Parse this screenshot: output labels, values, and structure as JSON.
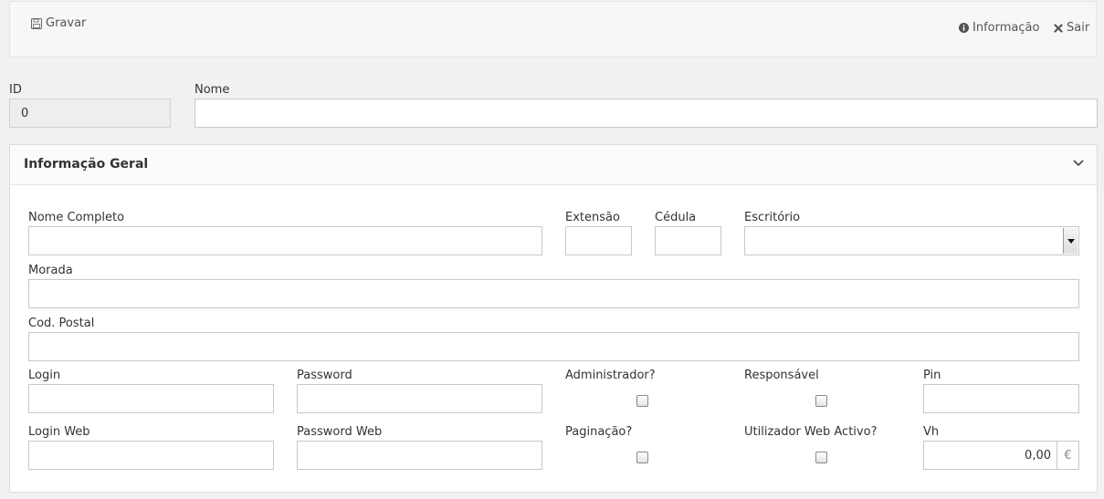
{
  "toolbar": {
    "save_label": "Gravar",
    "info_label": "Informação",
    "exit_label": "Sair"
  },
  "header_fields": {
    "id_label": "ID",
    "id_value": "0",
    "nome_label": "Nome",
    "nome_value": ""
  },
  "panel": {
    "title": "Informação Geral",
    "fields": {
      "nome_completo": {
        "label": "Nome Completo",
        "value": ""
      },
      "extensao": {
        "label": "Extensão",
        "value": ""
      },
      "cedula": {
        "label": "Cédula",
        "value": ""
      },
      "escritorio": {
        "label": "Escritório",
        "value": ""
      },
      "morada": {
        "label": "Morada",
        "value": ""
      },
      "cod_postal": {
        "label": "Cod. Postal",
        "value": ""
      },
      "login": {
        "label": "Login",
        "value": ""
      },
      "password": {
        "label": "Password",
        "value": ""
      },
      "administrador": {
        "label": "Administrador?",
        "checked": false
      },
      "responsavel": {
        "label": "Responsável",
        "checked": false
      },
      "pin": {
        "label": "Pin",
        "value": ""
      },
      "login_web": {
        "label": "Login Web",
        "value": ""
      },
      "password_web": {
        "label": "Password Web",
        "value": ""
      },
      "paginacao": {
        "label": "Paginação?",
        "checked": false
      },
      "utilizador_web_activo": {
        "label": "Utilizador Web Activo?",
        "checked": false
      },
      "vh": {
        "label": "Vh",
        "value": "0,00",
        "unit": "€"
      }
    }
  },
  "colors": {
    "background": "#f1f1f1",
    "toolbar_bg": "#f7f7f7",
    "panel_bg": "#ffffff",
    "readonly_bg": "#eeeeee",
    "border": "#c8c8c8"
  }
}
